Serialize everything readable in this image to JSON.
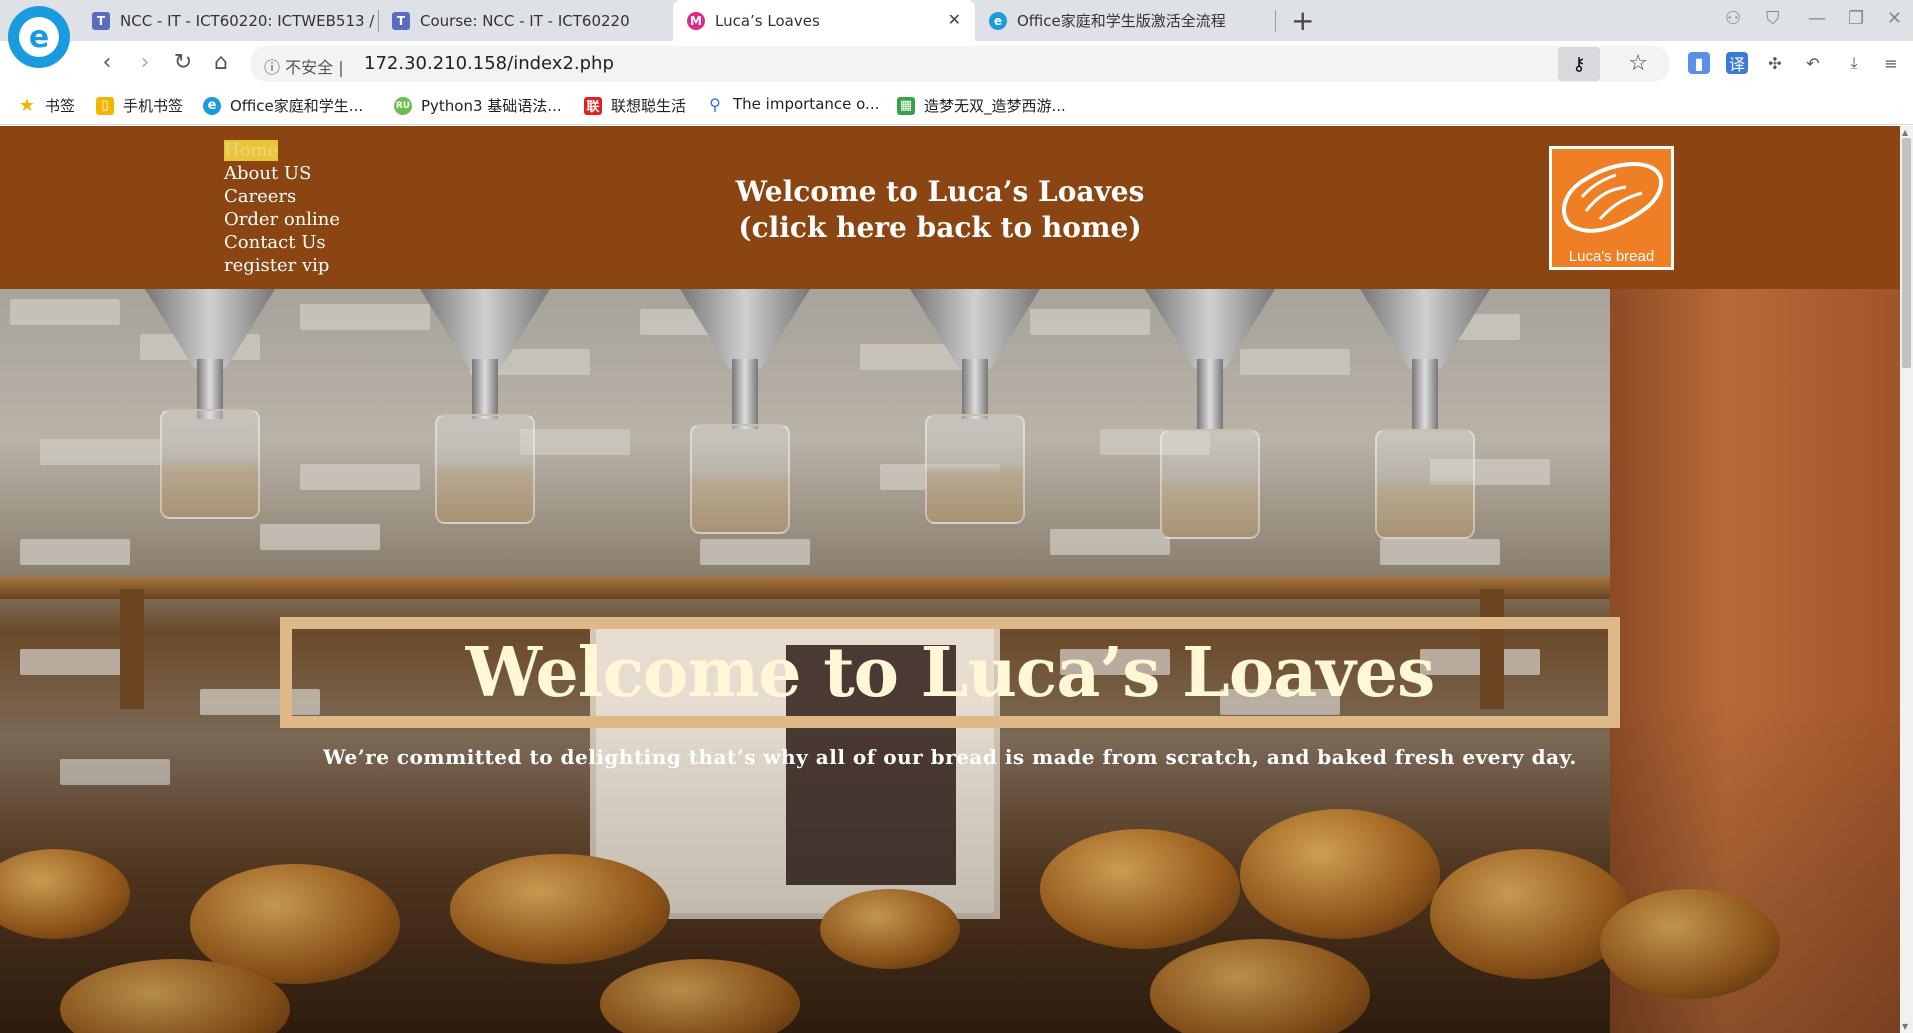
{
  "browser": {
    "tabs": [
      {
        "title": "NCC - IT - ICT60220: ICTWEB513 /",
        "icon_letter": "T",
        "icon_color": "#5b6bbf"
      },
      {
        "title": "Course: NCC - IT - ICT60220",
        "icon_letter": "T",
        "icon_color": "#5b6bbf"
      },
      {
        "title": "Luca’s Loaves",
        "icon_letter": "M",
        "icon_color": "#e0278a"
      },
      {
        "title": "Office家庭和学生版激活全流程",
        "icon_letter": "e",
        "icon_color": "#1a9be0"
      }
    ],
    "address": {
      "security_label": "不安全",
      "url": "172.30.210.158/index2.php"
    },
    "bookmarks": [
      {
        "label": "书签",
        "icon": "star-icon",
        "color": "#f4b400"
      },
      {
        "label": "手机书签",
        "icon": "phone-bookmark-icon",
        "color": "#f4b400"
      },
      {
        "label": "Office家庭和学生...",
        "icon": "edge-icon",
        "color": "#1a9be0"
      },
      {
        "label": "Python3 基础语法...",
        "icon": "python-site-icon",
        "color": "#6cbf4b"
      },
      {
        "label": "联想聪生活",
        "icon": "lenovo-icon",
        "color": "#e02020"
      },
      {
        "label": "The importance o...",
        "icon": "search-icon",
        "color": "#3a6fd8"
      },
      {
        "label": "造梦无双_造梦西游...",
        "icon": "game-icon",
        "color": "#3aa04a"
      }
    ]
  },
  "site": {
    "nav": [
      "Home",
      "About US",
      "Careers",
      "Order online",
      "Contact Us",
      "register vip"
    ],
    "header_title_line1": "Welcome to Luca’s Loaves",
    "header_title_line2": "(click here back to home)",
    "logo_text": "Luca's bread",
    "hero_title": "Welcome to Luca’s Loaves",
    "hero_subtitle": "We’re committed to delighting that’s why all of our bread is made from scratch, and baked fresh every day.",
    "colors": {
      "header_bg": "#8b4513",
      "nav_current_highlight": "#e8c63a",
      "hero_frame": "#deb887",
      "hero_title": "#fff7d6",
      "logo_bg": "#ee7f25"
    }
  }
}
